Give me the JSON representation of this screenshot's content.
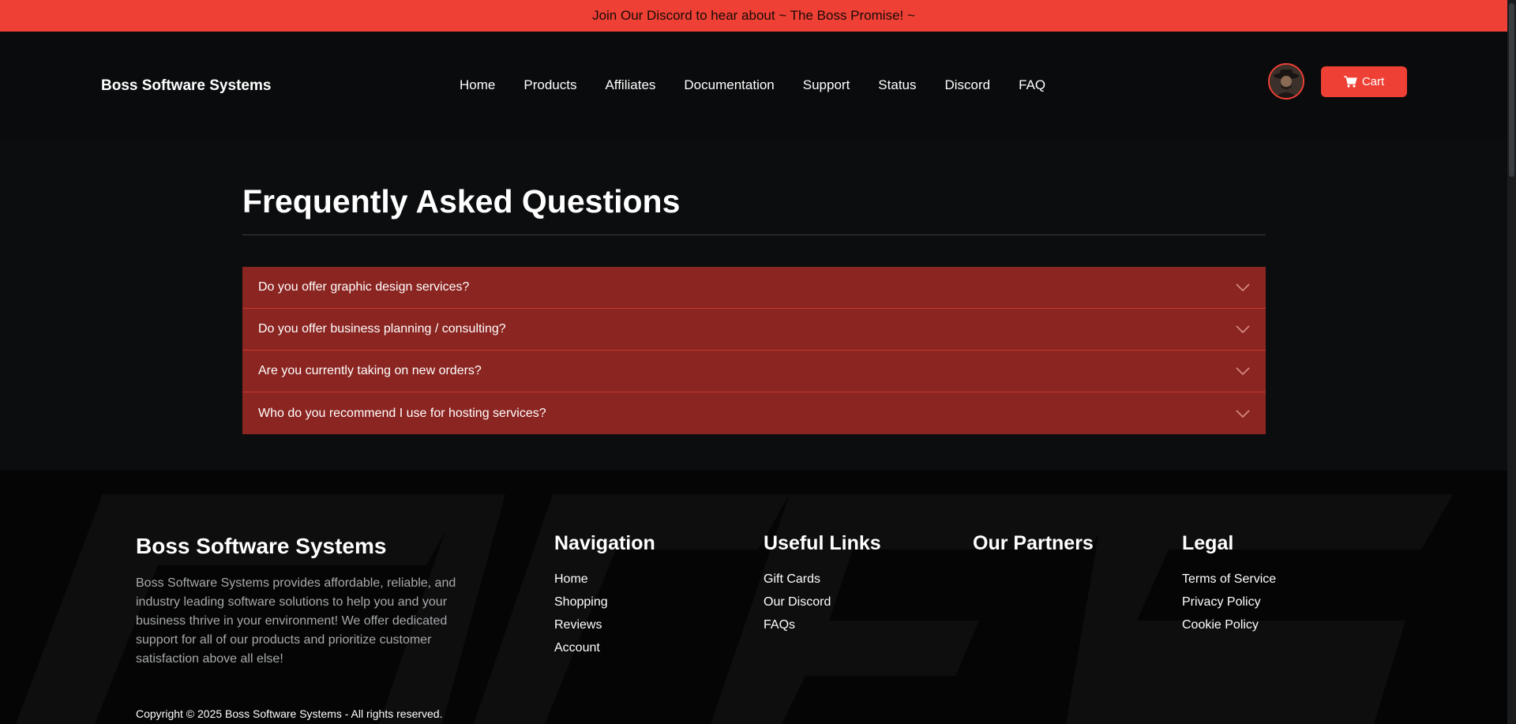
{
  "announcement": "Join Our Discord to hear about ~ The Boss Promise! ~",
  "header": {
    "brand": "Boss Software Systems",
    "nav": [
      "Home",
      "Products",
      "Affiliates",
      "Documentation",
      "Support",
      "Status",
      "Discord",
      "FAQ"
    ],
    "cart_label": "Cart",
    "cart_icon": "cart-icon",
    "avatar_icon": "user-avatar"
  },
  "faq": {
    "title": "Frequently Asked Questions",
    "items": [
      "Do you offer graphic design services?",
      "Do you offer business planning / consulting?",
      "Are you currently taking on new orders?",
      "Who do you recommend I use for hosting services?"
    ]
  },
  "footer": {
    "brand": "Boss Software Systems",
    "description": "Boss Software Systems provides affordable, reliable, and industry leading software solutions to help you and your business thrive in your environment! We offer dedicated support for all of our products and prioritize customer satisfaction above all else!",
    "columns": [
      {
        "title": "Navigation",
        "links": [
          "Home",
          "Shopping",
          "Reviews",
          "Account"
        ]
      },
      {
        "title": "Useful Links",
        "links": [
          "Gift Cards",
          "Our Discord",
          "FAQs"
        ]
      },
      {
        "title": "Our Partners",
        "links": []
      },
      {
        "title": "Legal",
        "links": [
          "Terms of Service",
          "Privacy Policy",
          "Cookie Policy"
        ]
      }
    ],
    "copyright": "Copyright © 2025 Boss Software Systems - All rights reserved."
  },
  "colors": {
    "accent": "#ee4035",
    "faq_bg": "#8b2521",
    "background": "#0b0d0f"
  }
}
